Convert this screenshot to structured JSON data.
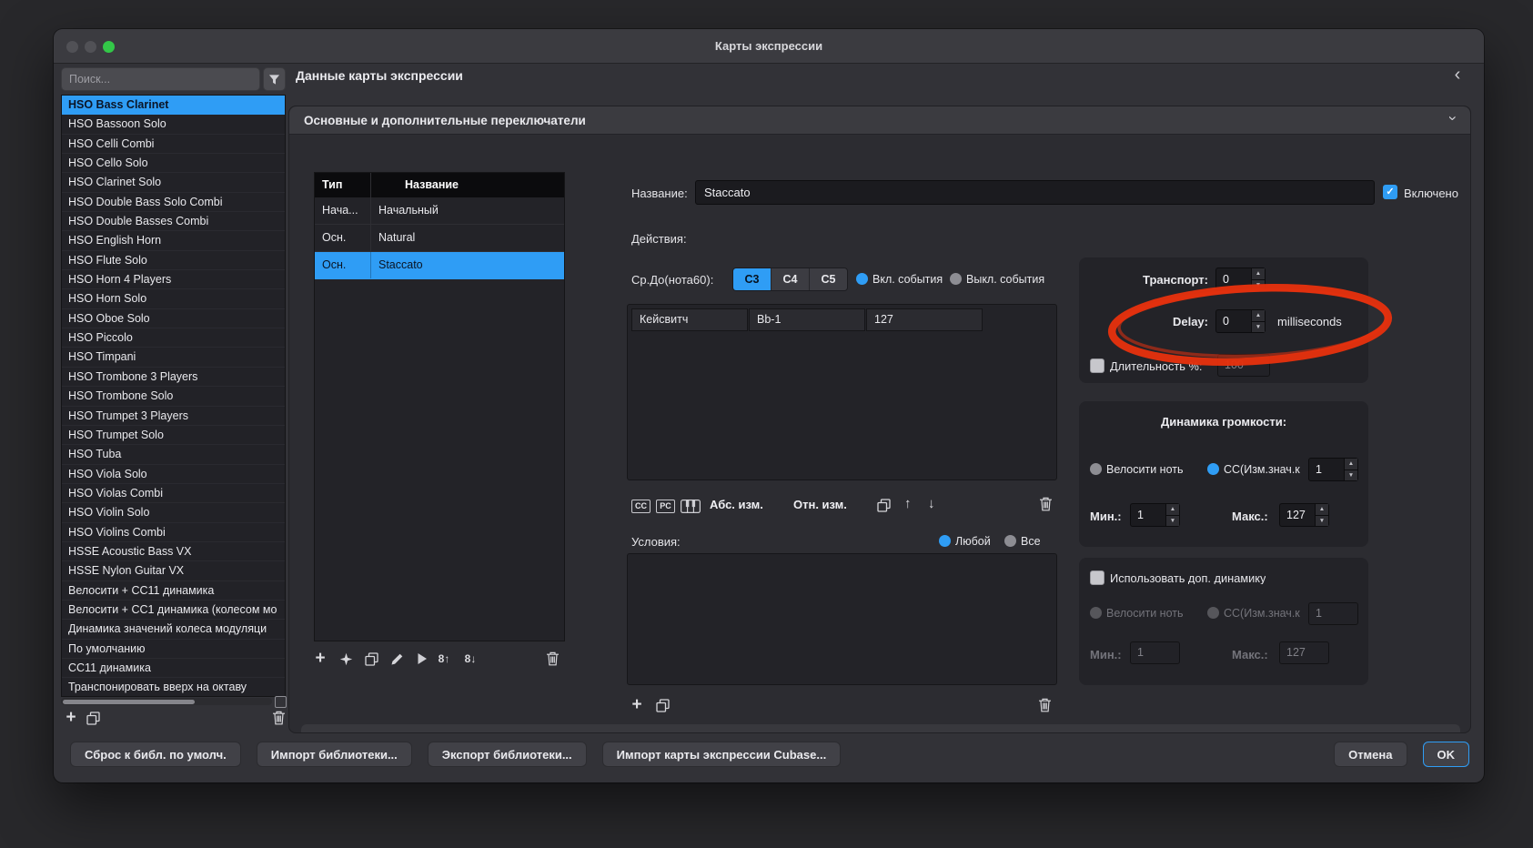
{
  "window": {
    "title": "Карты экспрессии",
    "collapse_icon": "‹"
  },
  "sidebar": {
    "search_placeholder": "Поиск...",
    "selected_index": 0,
    "items": [
      "HSO Bass Clarinet",
      "HSO Bassoon Solo",
      "HSO Celli Combi",
      "HSO Cello Solo",
      "HSO Clarinet Solo",
      "HSO Double Bass Solo Combi",
      "HSO Double Basses Combi",
      "HSO English Horn",
      "HSO Flute Solo",
      "HSO Horn 4 Players",
      "HSO Horn Solo",
      "HSO Oboe Solo",
      "HSO Piccolo",
      "HSO Timpani",
      "HSO Trombone 3 Players",
      "HSO Trombone Solo",
      "HSO Trumpet 3 Players",
      "HSO Trumpet Solo",
      "HSO Tuba",
      "HSO Viola Solo",
      "HSO Violas Combi",
      "HSO Violin Solo",
      "HSO Violins Combi",
      "HSSE Acoustic Bass VX",
      "HSSE Nylon Guitar VX",
      "Велосити + CC11 динамика",
      "Велосити + CC1 динамика (колесом мо",
      "Динамика значений колеса модуляци",
      "По умолчанию",
      "CC11 динамика",
      "Транспонировать вверх на октаву"
    ]
  },
  "header": {
    "title": "Данные карты экспрессии"
  },
  "section": {
    "title": "Основные и дополнительные переключатели"
  },
  "slots": {
    "columns": {
      "type": "Тип",
      "name": "Название"
    },
    "rows": [
      {
        "type": "Нача...",
        "name": "Начальный",
        "selected": false
      },
      {
        "type": "Осн.",
        "name": "Natural",
        "selected": false
      },
      {
        "type": "Осн.",
        "name": "Staccato",
        "selected": true
      }
    ]
  },
  "name_row": {
    "label": "Название:",
    "value": "Staccato"
  },
  "enabled": {
    "label": "Включено",
    "checked": true
  },
  "actions": {
    "label": "Действия:"
  },
  "root_key": {
    "label": "Ср.До(нота60):",
    "keys": [
      "C3",
      "C4",
      "C5"
    ],
    "selected_key": "C3",
    "on_label": "Вкл. события",
    "off_label": "Выкл. события"
  },
  "output_event": {
    "type": "Кейсвитч",
    "data1": "Bb-1",
    "data2": "127"
  },
  "output_toolbar": {
    "cc": "CC",
    "pc": "PC",
    "abs": "Абс. изм.",
    "rel": "Отн. изм.",
    "octave_up": "8↑",
    "octave_down": "8↓"
  },
  "conditions": {
    "label": "Условия:",
    "any_label": "Любой",
    "all_label": "Все"
  },
  "transport": {
    "label": "Транспорт:",
    "value": "0"
  },
  "delay": {
    "label": "Delay:",
    "value": "0",
    "unit": "milliseconds"
  },
  "length": {
    "label": "Длительность %:",
    "value": "100",
    "checked": false
  },
  "volume_dynamics": {
    "title": "Динамика громкости:",
    "velocity_label": "Велосити ноть",
    "cc_label": "CC(Изм.знач.к",
    "cc_value": "1",
    "min_label": "Мин.:",
    "min_value": "1",
    "max_label": "Макс.:",
    "max_value": "127"
  },
  "extra_dynamics": {
    "title": "Использовать доп. динамику",
    "checked": false,
    "velocity_label": "Велосити ноть",
    "cc_label": "CC(Изм.знач.к",
    "cc_value": "1",
    "min_label": "Мин.:",
    "min_value": "1",
    "max_label": "Макс.:",
    "max_value": "127"
  },
  "footer": {
    "buttons": [
      "Сброс к библ. по умолч.",
      "Импорт библиотеки...",
      "Экспорт библиотеки...",
      "Импорт карты экспрессии Cubase..."
    ],
    "cancel": "Отмена",
    "ok": "OK"
  },
  "annotation": {
    "shape": "hand-drawn-ellipse",
    "target": "delay-row",
    "color": "#e5310e"
  }
}
